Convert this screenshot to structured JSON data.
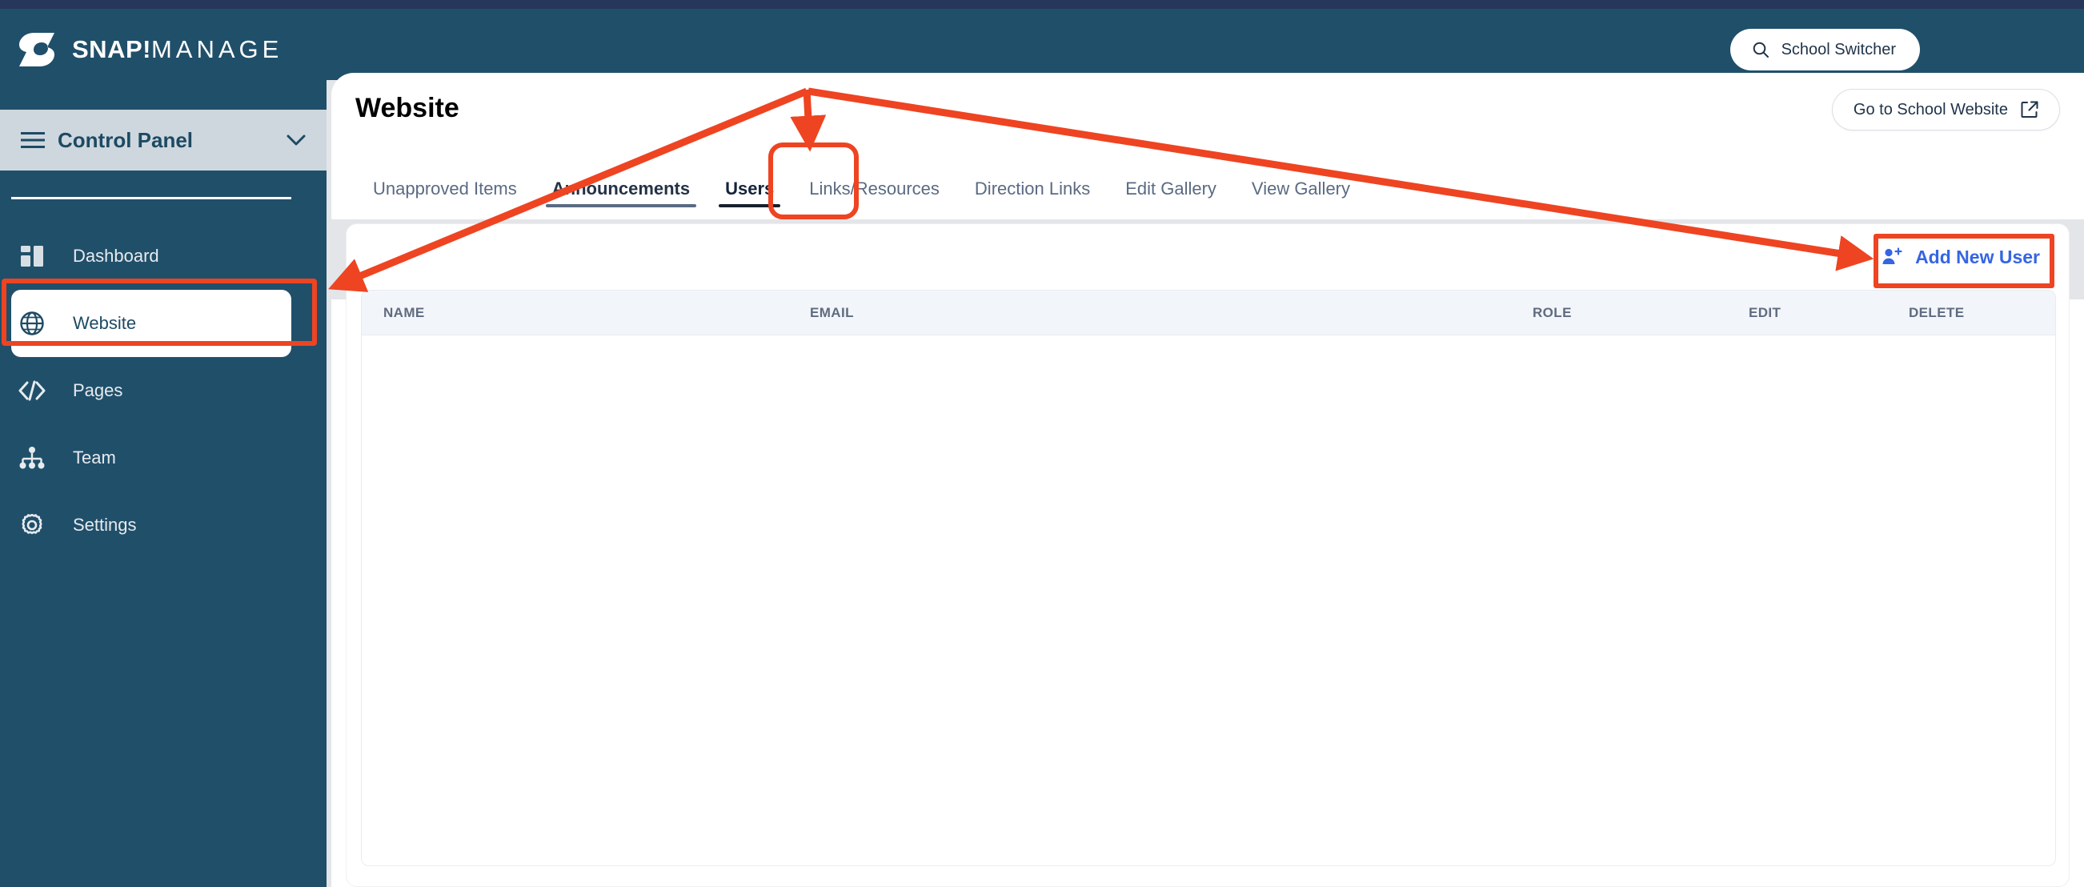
{
  "app": {
    "brand_primary": "SNAP!",
    "brand_secondary": "MANAGE",
    "header_bg": "#204f6a",
    "accent_blue": "#3565e3",
    "annotation_color": "#ee4422"
  },
  "topbar": {
    "logo_icon": "snap-s-logo-icon",
    "school_switcher": {
      "label": "School Switcher",
      "icon": "search-icon"
    }
  },
  "sidebar": {
    "control_panel": {
      "label": "Control Panel",
      "menu_icon": "hamburger-icon",
      "chevron_icon": "chevron-down-icon"
    },
    "items": [
      {
        "label": "Dashboard",
        "icon": "dashboard-layout-icon",
        "active": false
      },
      {
        "label": "Website",
        "icon": "globe-icon",
        "active": true
      },
      {
        "label": "Pages",
        "icon": "code-brackets-icon",
        "active": false
      },
      {
        "label": "Team",
        "icon": "org-chart-icon",
        "active": false
      },
      {
        "label": "Settings",
        "icon": "gear-icon",
        "active": false
      }
    ]
  },
  "main": {
    "title": "Website",
    "go_to_site": {
      "label": "Go to School Website",
      "icon": "external-link-icon"
    },
    "tabs": [
      {
        "label": "Unapproved Items",
        "state": "normal"
      },
      {
        "label": "Announcements",
        "state": "semi"
      },
      {
        "label": "Users",
        "state": "active"
      },
      {
        "label": "Links/Resources",
        "state": "normal"
      },
      {
        "label": "Direction Links",
        "state": "normal"
      },
      {
        "label": "Edit Gallery",
        "state": "normal"
      },
      {
        "label": "View Gallery",
        "state": "normal"
      }
    ],
    "toolbar": {
      "add_new_user": {
        "label": "Add New User",
        "icon": "user-plus-icon"
      }
    },
    "table": {
      "columns": [
        "NAME",
        "EMAIL",
        "ROLE",
        "EDIT",
        "DELETE"
      ],
      "rows": []
    }
  },
  "annotations": {
    "highlight_boxes": [
      {
        "target": "sidebar-item-website"
      },
      {
        "target": "tab-users"
      },
      {
        "target": "add-new-user-button"
      }
    ],
    "arrows": [
      {
        "from": "fan-vertex",
        "to": "sidebar-item-website"
      },
      {
        "from": "fan-vertex",
        "to": "tab-users"
      },
      {
        "from": "fan-vertex",
        "to": "add-new-user-button"
      }
    ]
  }
}
